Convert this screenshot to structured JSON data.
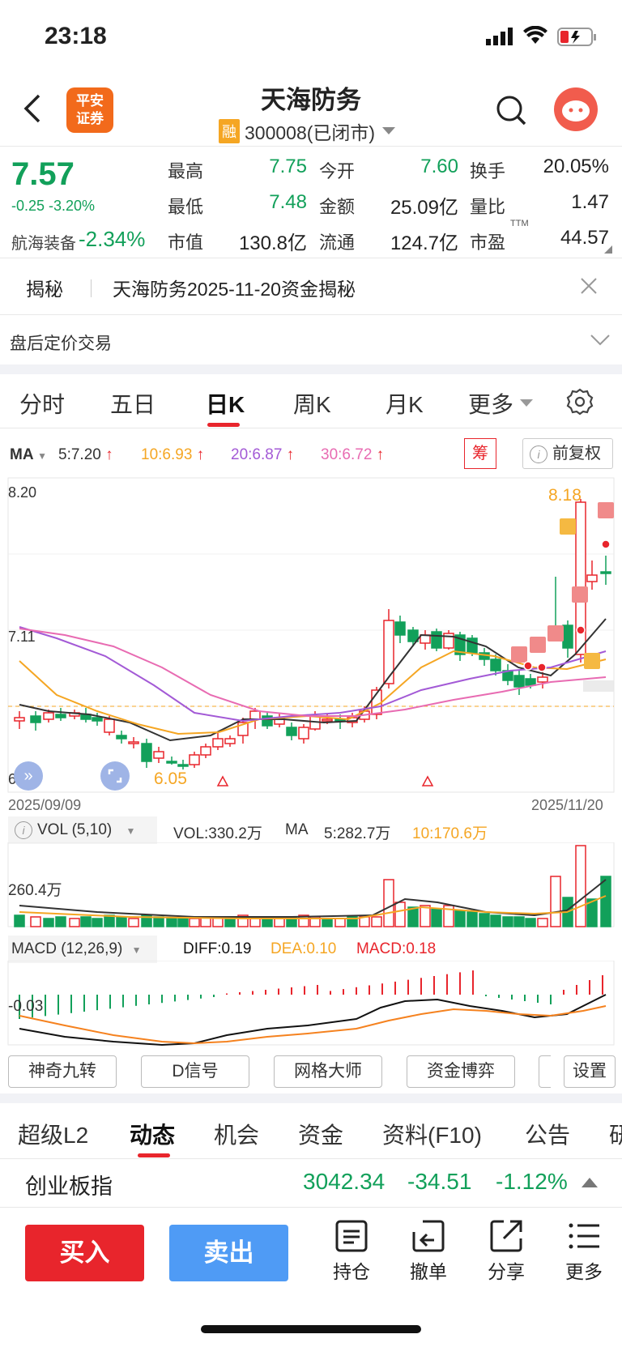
{
  "status_bar": {
    "time": "23:18"
  },
  "header": {
    "logo_text_1": "平安",
    "logo_text_2": "证券",
    "title": "天海防务",
    "rong_badge": "融",
    "code_status": "300008(已闭市)"
  },
  "quote": {
    "price": "7.57",
    "change": "-0.25 -3.20%",
    "sector_name": "航海装备",
    "sector_change": "-2.34%",
    "rows": [
      [
        {
          "label": "最高",
          "value": "7.75"
        },
        {
          "label": "今开",
          "value": "7.60"
        },
        {
          "label": "换手",
          "value": "20.05%"
        }
      ],
      [
        {
          "label": "最低",
          "value": "7.48"
        },
        {
          "label": "金额",
          "value": "25.09亿"
        },
        {
          "label": "量比",
          "value": "1.47"
        }
      ],
      [
        {
          "label": "市值",
          "value": "130.8亿"
        },
        {
          "label": "流通",
          "value": "124.7亿"
        },
        {
          "label": "市盈",
          "value": "44.57"
        }
      ]
    ],
    "pe_sup": "TTM"
  },
  "reveal": {
    "tag": "揭秘",
    "text": "天海防务2025-11-20资金揭秘"
  },
  "after_hours": "盘后定价交易",
  "chart_tabs": [
    "分时",
    "五日",
    "日K",
    "周K",
    "月K",
    "更多"
  ],
  "chart_tab_active": 2,
  "ma_legend": {
    "label": "MA",
    "ma5": "5:7.20",
    "ma10": "10:6.93",
    "ma20": "20:6.87",
    "ma30": "30:6.72",
    "chip": "筹",
    "restore": "前复权"
  },
  "kline": {
    "y_top": "8.20",
    "y_mid": "7.11",
    "y_bottom": "6.03",
    "low_label": "6.05",
    "high_label": "8.18",
    "date_start": "2025/09/09",
    "date_end": "2025/11/20",
    "buy_mark": "买",
    "t_mark": "T"
  },
  "vol_legend": {
    "label": "VOL (5,10)",
    "vol": "VOL:330.2万",
    "ma": "MA",
    "ma5": "5:282.7万",
    "ma10": "10:170.6万",
    "axis": "260.4万"
  },
  "macd_legend": {
    "label": "MACD (12,26,9)",
    "diff": "DIFF:0.19",
    "dea": "DEA:0.10",
    "macd": "MACD:0.18",
    "axis": "-0.03"
  },
  "tool_buttons": [
    "神奇九转",
    "D信号",
    "网格大师",
    "资金博弈",
    "设置"
  ],
  "bottom_tabs": [
    "超级L2",
    "动态",
    "机会",
    "资金",
    "资料(F10)",
    "公告",
    "研"
  ],
  "index_bar": {
    "name": "创业板指",
    "value": "3042.34",
    "change": "-34.51",
    "pct": "-1.12%"
  },
  "actions": {
    "buy": "买入",
    "sell": "卖出",
    "tools": [
      "持仓",
      "撤单",
      "分享",
      "更多"
    ]
  },
  "colors": {
    "up": "#e8252c",
    "down": "#12a05a",
    "ma5": "#333333",
    "ma10": "#f5a623",
    "ma20": "#a35ad6",
    "ma30": "#e86bb2"
  }
}
